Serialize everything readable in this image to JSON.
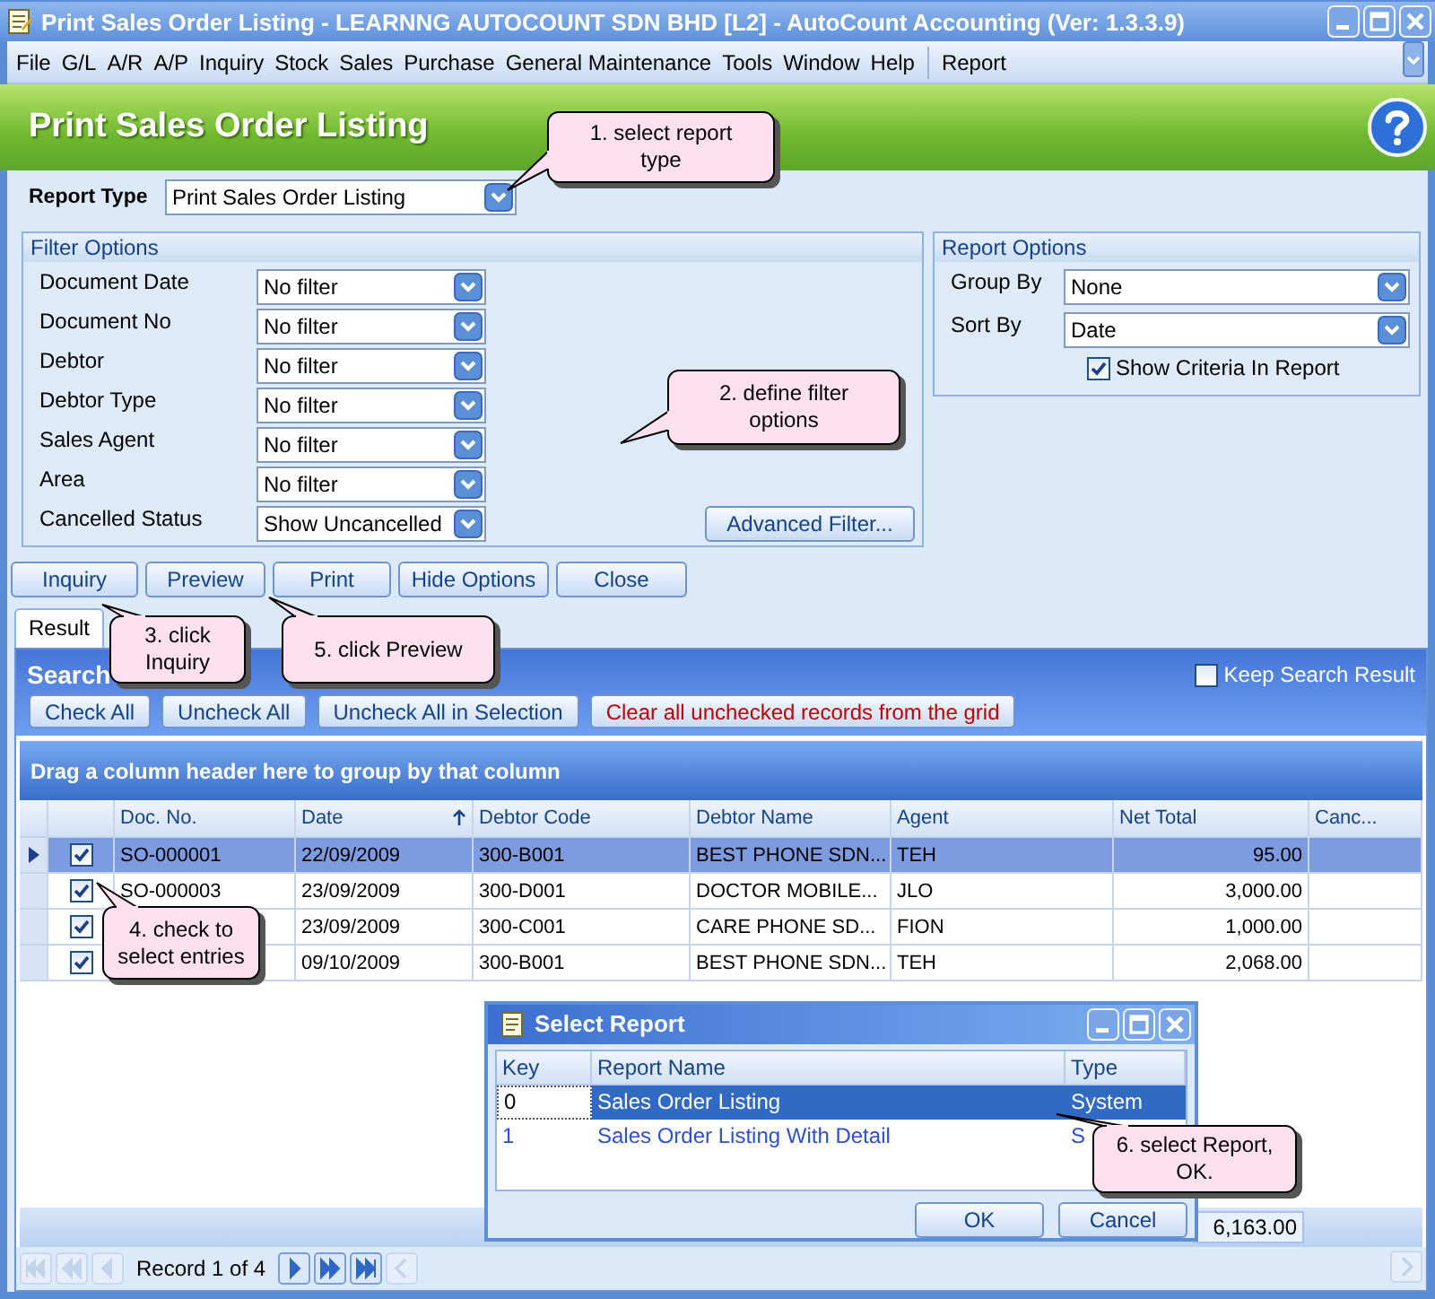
{
  "window": {
    "title": "Print Sales Order Listing - LEARNNG AUTOCOUNT SDN BHD [L2] - AutoCount Accounting (Ver: 1.3.3.9)"
  },
  "menu": [
    {
      "label": "File",
      "kind": "menu"
    },
    {
      "label": "G/L",
      "kind": "menu"
    },
    {
      "label": "A/R",
      "kind": "menu"
    },
    {
      "label": "A/P",
      "kind": "menu"
    },
    {
      "label": "Inquiry",
      "kind": "menu"
    },
    {
      "label": "Stock",
      "kind": "menu"
    },
    {
      "label": "Sales",
      "kind": "menu"
    },
    {
      "label": "Purchase",
      "kind": "menu"
    },
    {
      "label": "General Maintenance",
      "kind": "menu"
    },
    {
      "label": "Tools",
      "kind": "menu"
    },
    {
      "label": "Window",
      "kind": "menu"
    },
    {
      "label": "Help",
      "kind": "menu"
    },
    {
      "label": "Report",
      "kind": "command"
    }
  ],
  "header": {
    "title": "Print Sales Order Listing"
  },
  "report_type": {
    "label": "Report Type",
    "value": "Print Sales Order Listing"
  },
  "filter_options": {
    "title": "Filter Options",
    "fields": [
      {
        "label": "Document Date",
        "value": "No filter"
      },
      {
        "label": "Document No",
        "value": "No filter"
      },
      {
        "label": "Debtor",
        "value": "No filter"
      },
      {
        "label": "Debtor Type",
        "value": "No filter"
      },
      {
        "label": "Sales Agent",
        "value": "No filter"
      },
      {
        "label": "Area",
        "value": "No filter"
      },
      {
        "label": "Cancelled Status",
        "value": "Show Uncancelled"
      }
    ],
    "advanced_button": "Advanced Filter..."
  },
  "report_options": {
    "title": "Report Options",
    "fields": [
      {
        "label": "Group By",
        "value": "None"
      },
      {
        "label": "Sort By",
        "value": "Date"
      }
    ],
    "show_criteria": {
      "label": "Show Criteria In Report",
      "checked": true
    }
  },
  "buttons": [
    "Inquiry",
    "Preview",
    "Print",
    "Hide Options",
    "Close"
  ],
  "tabs": [
    {
      "label": "Result",
      "selected": true
    }
  ],
  "search": {
    "title": "Search",
    "keep_search": {
      "label": "Keep Search Result",
      "checked": false
    },
    "buttons": [
      {
        "label": "Check All",
        "kind": "normal"
      },
      {
        "label": "Uncheck All",
        "kind": "normal"
      },
      {
        "label": "Uncheck All in Selection",
        "kind": "normal"
      },
      {
        "label": "Clear all unchecked records from the grid",
        "kind": "warning"
      }
    ]
  },
  "group_panel": {
    "text": "Drag a column header here to group by that column"
  },
  "table": {
    "columns": [
      {
        "label": "Doc. No.",
        "sorted": false
      },
      {
        "label": "Date",
        "sorted": true
      },
      {
        "label": "Debtor Code",
        "sorted": false
      },
      {
        "label": "Debtor Name",
        "sorted": false
      },
      {
        "label": "Agent",
        "sorted": false
      },
      {
        "label": "Net Total",
        "sorted": false
      },
      {
        "label": "Canc...",
        "sorted": false
      }
    ],
    "rows": [
      {
        "checked": true,
        "selected": true,
        "doc_no": "SO-000001",
        "date": "22/09/2009",
        "debtor_code": "300-B001",
        "debtor_name": "BEST PHONE SDN...",
        "agent": "TEH",
        "net_total": "95.00"
      },
      {
        "checked": true,
        "selected": false,
        "doc_no": "SO-000003",
        "date": "23/09/2009",
        "debtor_code": "300-D001",
        "debtor_name": "DOCTOR MOBILE...",
        "agent": "JLO",
        "net_total": "3,000.00"
      },
      {
        "checked": true,
        "selected": false,
        "date": "23/09/2009",
        "debtor_code": "300-C001",
        "debtor_name": "CARE PHONE SD...",
        "agent": "FION",
        "net_total": "1,000.00"
      },
      {
        "checked": true,
        "selected": false,
        "date": "09/10/2009",
        "debtor_code": "300-B001",
        "debtor_name": "BEST PHONE SDN...",
        "agent": "TEH",
        "net_total": "2,068.00"
      }
    ],
    "summary": {
      "net_total": "6,163.00"
    }
  },
  "navigator": {
    "record": "Record 1 of 4",
    "buttons": [
      {
        "kind": "first",
        "disabled": true
      },
      {
        "kind": "prev_page",
        "disabled": true
      },
      {
        "kind": "prev",
        "disabled": true
      },
      {
        "kind": "next",
        "disabled": false
      },
      {
        "kind": "next_page",
        "disabled": false
      },
      {
        "kind": "last",
        "disabled": false
      },
      {
        "kind": "scroll_left",
        "disabled": true
      }
    ]
  },
  "dialog": {
    "title": "Select Report",
    "columns": [
      "Key",
      "Report Name",
      "Type"
    ],
    "rows": [
      {
        "key": "0",
        "name": "Sales Order Listing",
        "type": "System",
        "selected": true
      },
      {
        "key": "1",
        "name": "Sales Order Listing With Detail",
        "type": "S",
        "selected": false
      }
    ],
    "buttons": [
      "OK",
      "Cancel"
    ]
  },
  "callouts": [
    {
      "text": "1. select report type"
    },
    {
      "text": "2. define filter options"
    },
    {
      "text": "3. click Inquiry"
    },
    {
      "text": "5. click Preview"
    },
    {
      "text": "4. check to select entries"
    },
    {
      "text": "6. select Report, OK."
    }
  ]
}
